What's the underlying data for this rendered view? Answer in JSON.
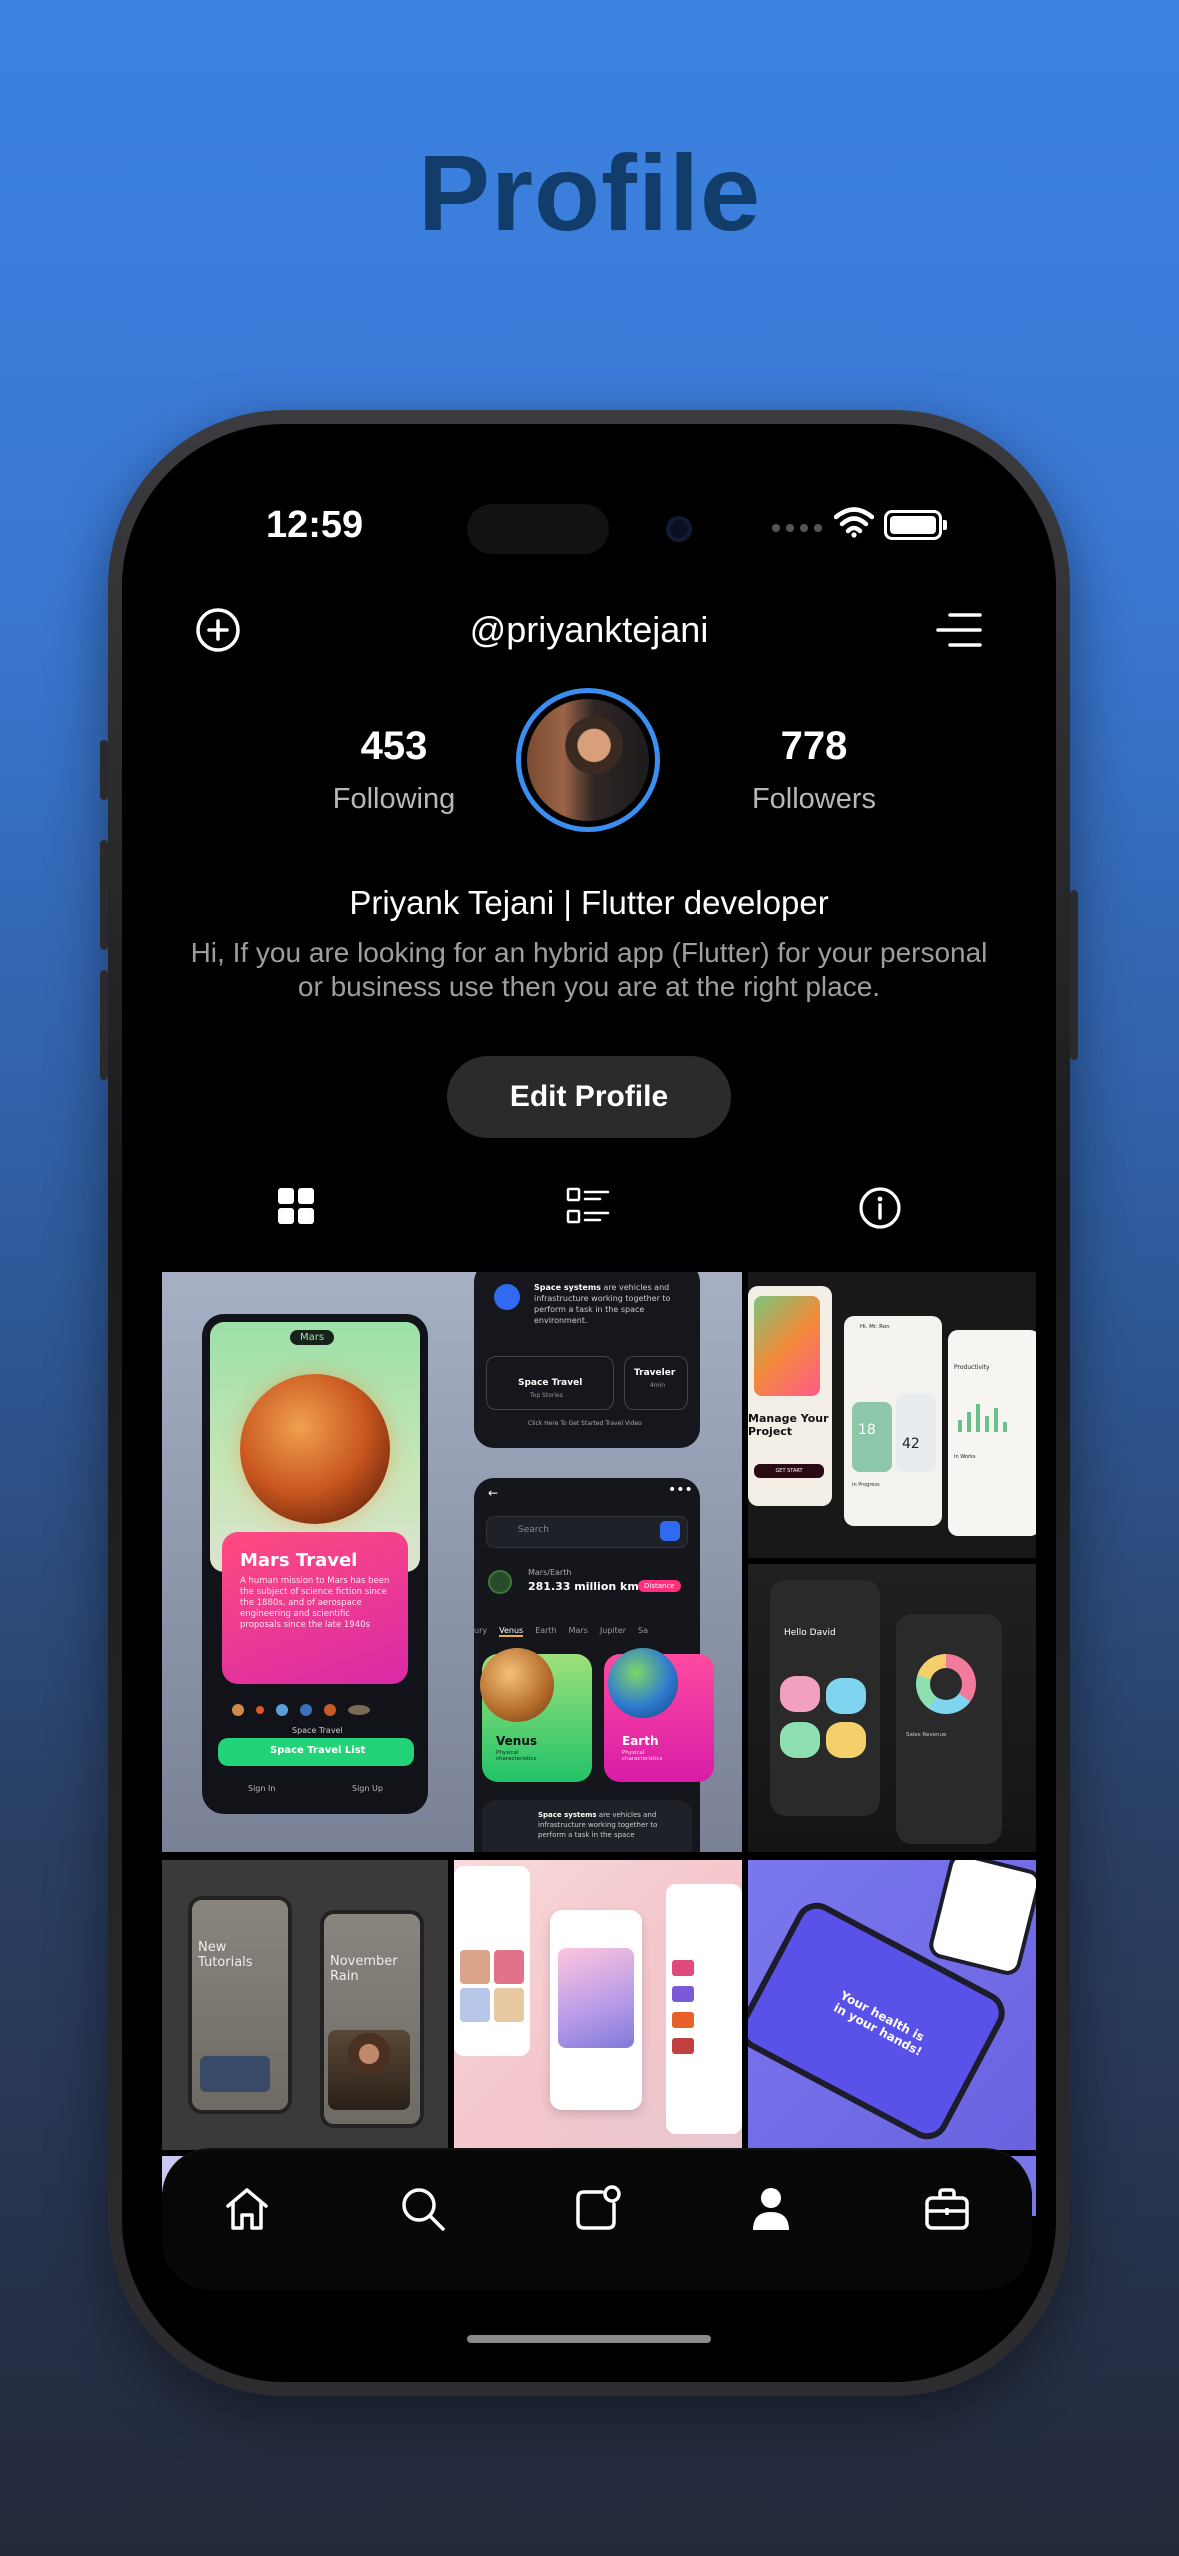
{
  "page_title": "Profile",
  "status_bar": {
    "time": "12:59"
  },
  "header": {
    "username": "@priyanktejani"
  },
  "stats": {
    "following_count": "453",
    "following_label": "Following",
    "followers_count": "778",
    "followers_label": "Followers"
  },
  "profile": {
    "name": "Priyank Tejani | Flutter developer",
    "bio": "Hi, If you are looking for an hybrid app (Flutter) for your personal or business use then you are at the right place.",
    "edit_button": "Edit Profile"
  },
  "tabs": [
    {
      "icon": "grid-icon"
    },
    {
      "icon": "list-icon"
    },
    {
      "icon": "info-icon"
    }
  ],
  "posts": {
    "mars": {
      "chip": "Mars",
      "title": "Mars Travel",
      "desc": "A human mission to Mars has been the subject of science fiction since the 1880s, and of aerospace engineering and scientific proposals since the late 1940s",
      "caption": "Space Travel",
      "list_button": "Space Travel List",
      "sign_in": "Sign In",
      "sign_up": "Sign Up"
    },
    "space_card": {
      "text_bold": "Space systems",
      "text_rest": "are vehicles and infrastructure working together to perform a task in the space environment.",
      "card1_title": "Space Travel",
      "card1_sub": "Top Stories",
      "card2_title": "Traveler",
      "card2_sub": "4min",
      "footer": "Click Here To Get Started Travel Video"
    },
    "planets": {
      "search_placeholder": "Search",
      "route": "Mars/Earth",
      "distance": "281.33 million km",
      "distance_btn": "Distance",
      "tabs": [
        "ury",
        "Venus",
        "Earth",
        "Mars",
        "Jupiter",
        "Sa"
      ],
      "venus": "Venus",
      "earth": "Earth",
      "sub": "Physical characteristics",
      "space_text_bold": "Space systems",
      "space_text_rest": "are vehicles and infrastructure working together to perform a task in the space"
    },
    "project": {
      "headline": "Manage Your Project",
      "cta": "GET START",
      "greeting": "Hi, Mr. Ron",
      "stat1": "18",
      "stat2": "42",
      "section": "In Progress",
      "productivity": "Productivity",
      "tasks": "In Works"
    },
    "finance": {
      "greeting": "Hello David",
      "section": "Sales Revenue"
    },
    "music": {
      "card1_title": "New Tutorials",
      "card2_title": "November Rain"
    },
    "health": {
      "headline": "Your health is in your hands!"
    }
  },
  "bottom_nav": [
    {
      "icon": "home-icon"
    },
    {
      "icon": "search-icon"
    },
    {
      "icon": "add-post-icon"
    },
    {
      "icon": "profile-icon"
    },
    {
      "icon": "briefcase-icon"
    }
  ]
}
